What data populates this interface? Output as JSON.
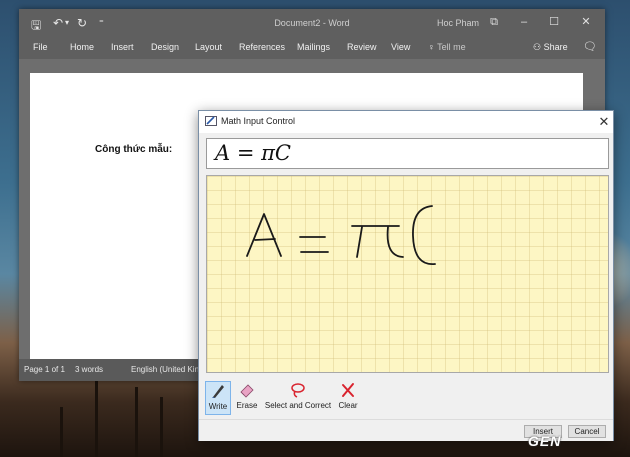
{
  "word": {
    "doc_title": "Document2 - Word",
    "user_name": "Hoc Pham",
    "tabs": [
      "File",
      "Home",
      "Insert",
      "Design",
      "Layout",
      "References",
      "Mailings",
      "Review",
      "View"
    ],
    "tell_me": "Tell me",
    "share": "Share",
    "document": {
      "formula_label": "Công thức mẫu:"
    },
    "status": {
      "page": "Page 1 of 1",
      "words": "3 words",
      "language": "English (United Kin"
    }
  },
  "math_input": {
    "title": "Math Input Control",
    "preview": "A = πC",
    "tools": [
      {
        "label": "Write",
        "icon": "pen-icon",
        "active": true
      },
      {
        "label": "Erase",
        "icon": "eraser-icon",
        "active": false
      },
      {
        "label": "Select and Correct",
        "icon": "lasso-icon",
        "active": false
      },
      {
        "label": "Clear",
        "icon": "clear-x-icon",
        "active": false
      }
    ],
    "insert_label": "Insert",
    "cancel_label": "Cancel"
  },
  "watermark": "GEN",
  "colors": {
    "ribbon": "#5f5f5f",
    "pad_background": "#fdf6c4",
    "active_tool": "#cce4f7",
    "clear_icon": "#d9232e",
    "lasso_icon": "#d9232e"
  }
}
